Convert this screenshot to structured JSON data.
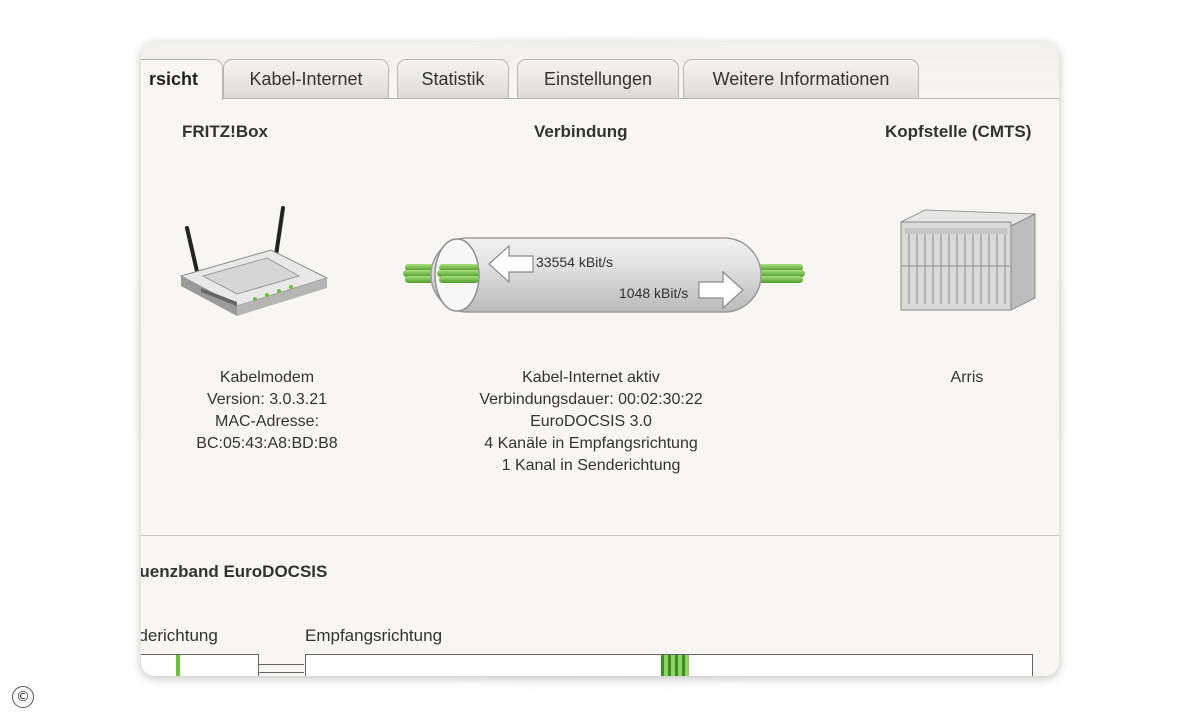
{
  "tabs": [
    {
      "label": "rsicht",
      "active": true
    },
    {
      "label": "Kabel-Internet",
      "active": false
    },
    {
      "label": "Statistik",
      "active": false
    },
    {
      "label": "Einstellungen",
      "active": false
    },
    {
      "label": "Weitere Informationen",
      "active": false
    }
  ],
  "fritzbox": {
    "heading": "FRITZ!Box",
    "type": "Kabelmodem",
    "version": "Version: 3.0.3.21",
    "mac_label": "MAC-Adresse:",
    "mac": "BC:05:43:A8:BD:B8"
  },
  "connection": {
    "heading": "Verbindung",
    "downstream": "33554 kBit/s",
    "upstream": "1048 kBit/s",
    "status": "Kabel-Internet aktiv",
    "duration": "Verbindungsdauer: 00:02:30:22",
    "standard": "EuroDOCSIS 3.0",
    "rx_channels": "4 Kanäle in Empfangsrichtung",
    "tx_channels": "1 Kanal in Senderichtung"
  },
  "cmts": {
    "heading": "Kopfstelle (CMTS)",
    "vendor": "Arris"
  },
  "frequency": {
    "title": "quenzband EuroDOCSIS",
    "send_label": "nderichtung",
    "receive_label": "Empfangsrichtung"
  },
  "footer": {
    "copyright_symbol": "©"
  },
  "colors": {
    "accent_green": "#6fbf3f",
    "tab_border": "#b8b6b0",
    "panel_bg": "#f7f6f3"
  }
}
